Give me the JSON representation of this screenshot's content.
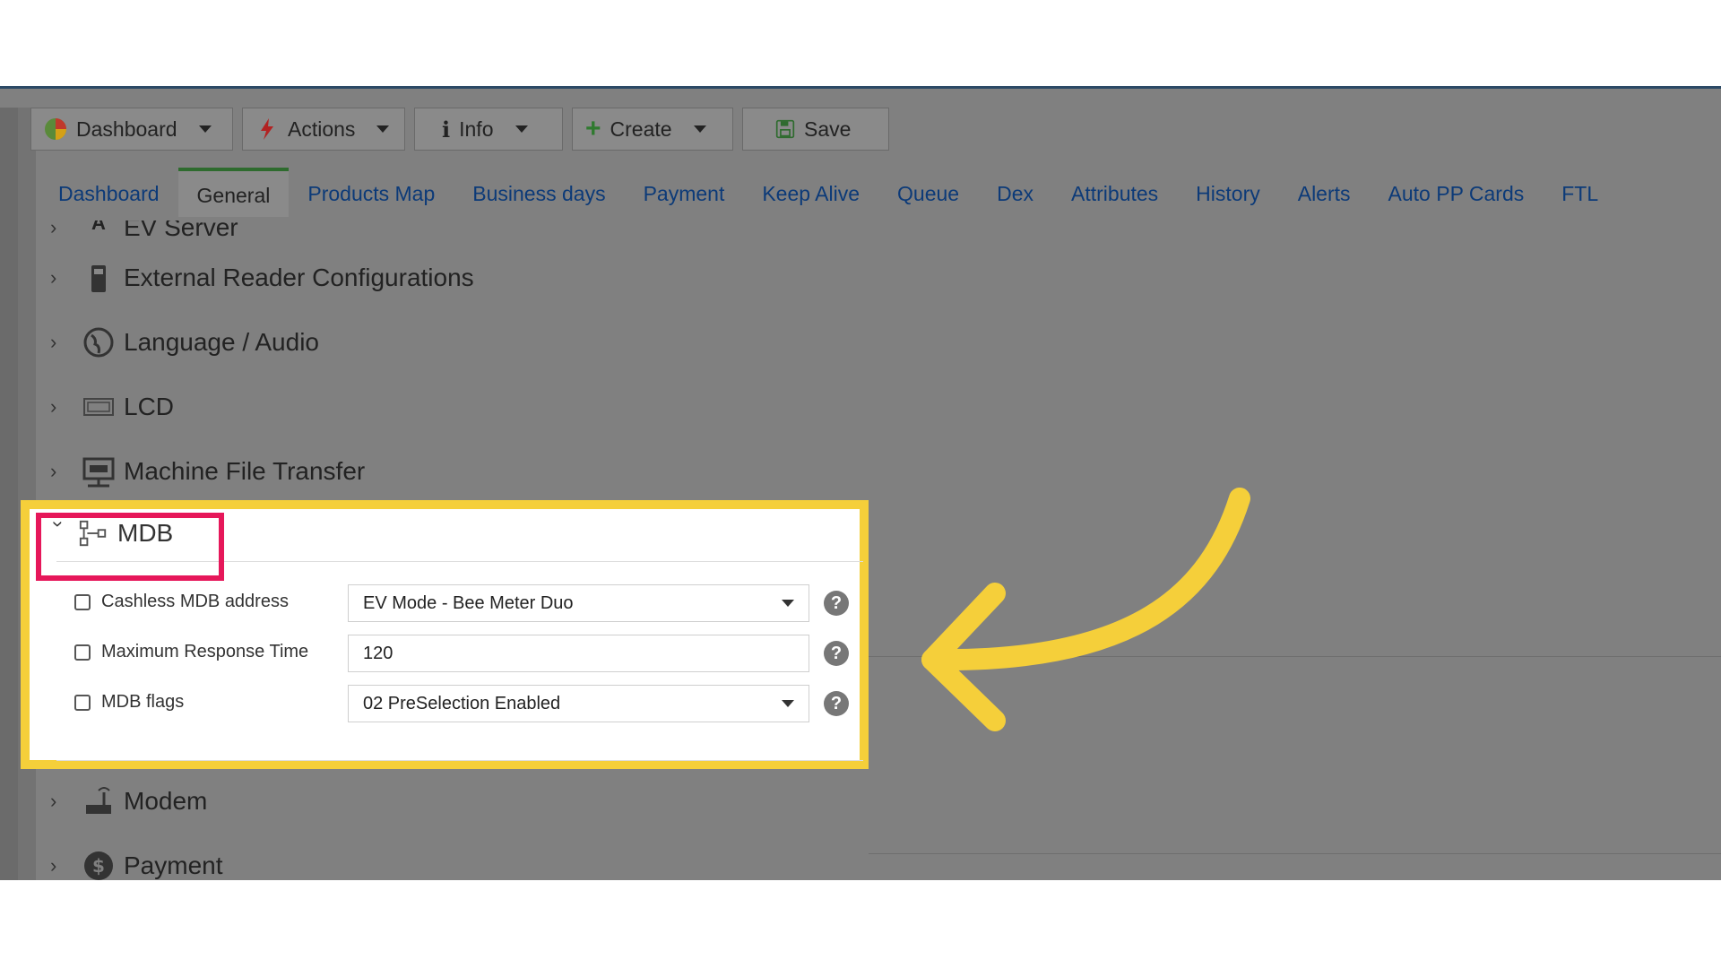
{
  "toolbar": {
    "dashboard": "Dashboard",
    "actions": "Actions",
    "info": "Info",
    "create": "Create",
    "save": "Save"
  },
  "tabs": [
    "Dashboard",
    "General",
    "Products Map",
    "Business days",
    "Payment",
    "Keep Alive",
    "Queue",
    "Dex",
    "Attributes",
    "History",
    "Alerts",
    "Auto PP Cards",
    "FTL"
  ],
  "active_tab": "General",
  "sections": {
    "ev_server": "EV Server",
    "external_reader": "External Reader Configurations",
    "language_audio": "Language / Audio",
    "lcd": "LCD",
    "machine_file_transfer": "Machine File Transfer",
    "mdb": "MDB",
    "modem": "Modem",
    "payment": "Payment"
  },
  "mdb": {
    "rows": [
      {
        "label": "Cashless MDB address",
        "value": "EV Mode - Bee Meter Duo",
        "type": "select"
      },
      {
        "label": "Maximum Response Time",
        "value": "120",
        "type": "text"
      },
      {
        "label": "MDB flags",
        "value": "02 PreSelection Enabled",
        "type": "select"
      }
    ],
    "help_glyph": "?"
  },
  "colors": {
    "highlight_yellow": "#f5cf3a",
    "highlight_red": "#e6175a",
    "tab_link": "#0c3a78",
    "overlay_gray": "#808080"
  }
}
